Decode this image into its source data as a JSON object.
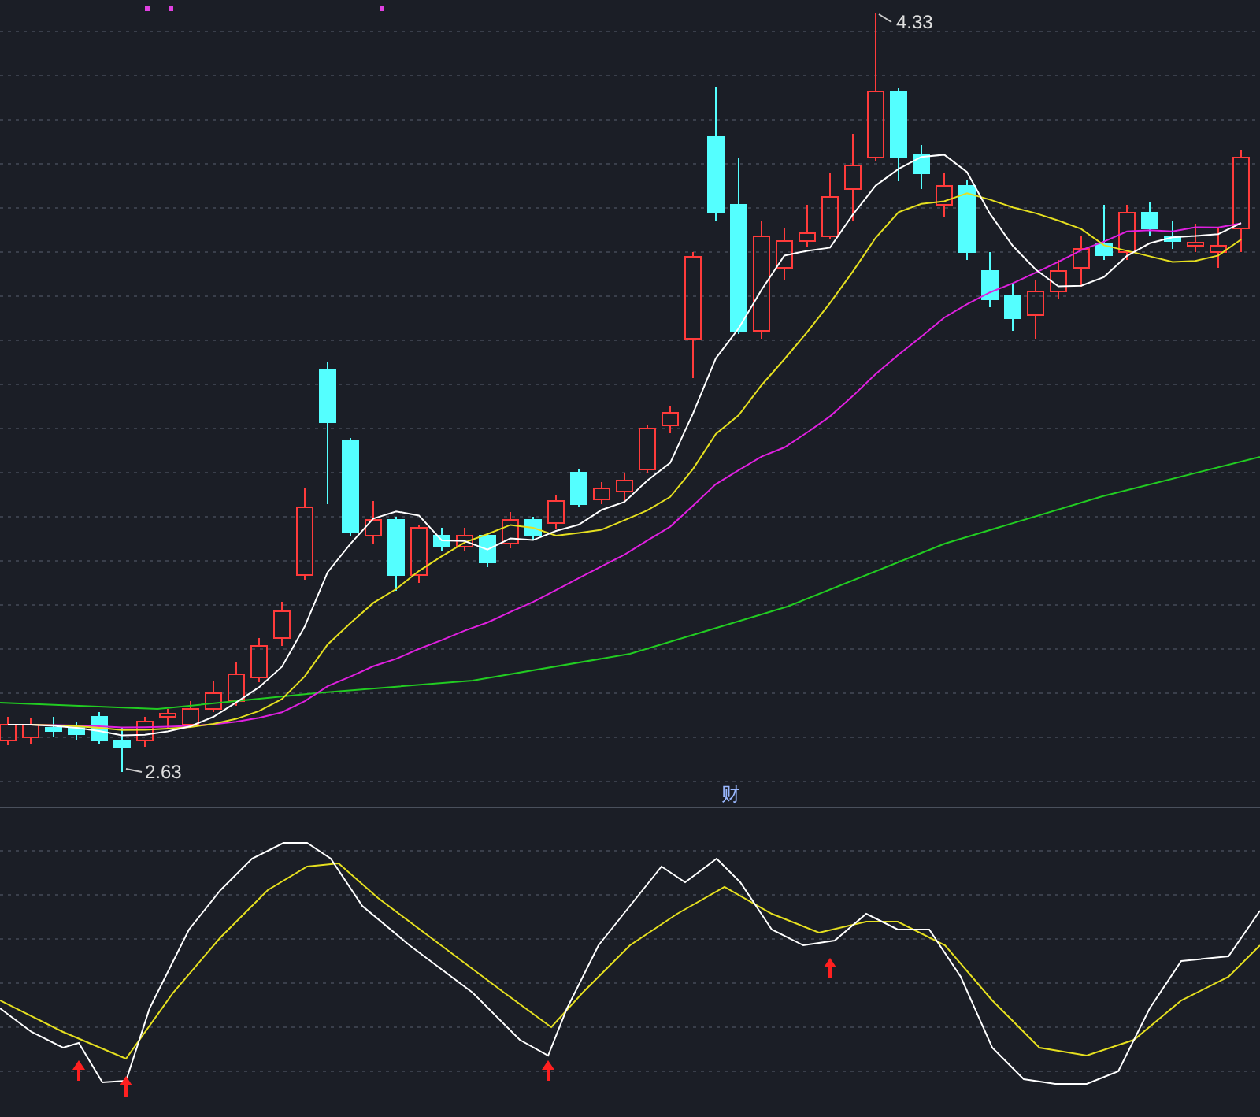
{
  "price_chart": {
    "high_label": "4.33",
    "low_label": "2.63"
  },
  "indicator_panel": {
    "title": "财"
  }
}
